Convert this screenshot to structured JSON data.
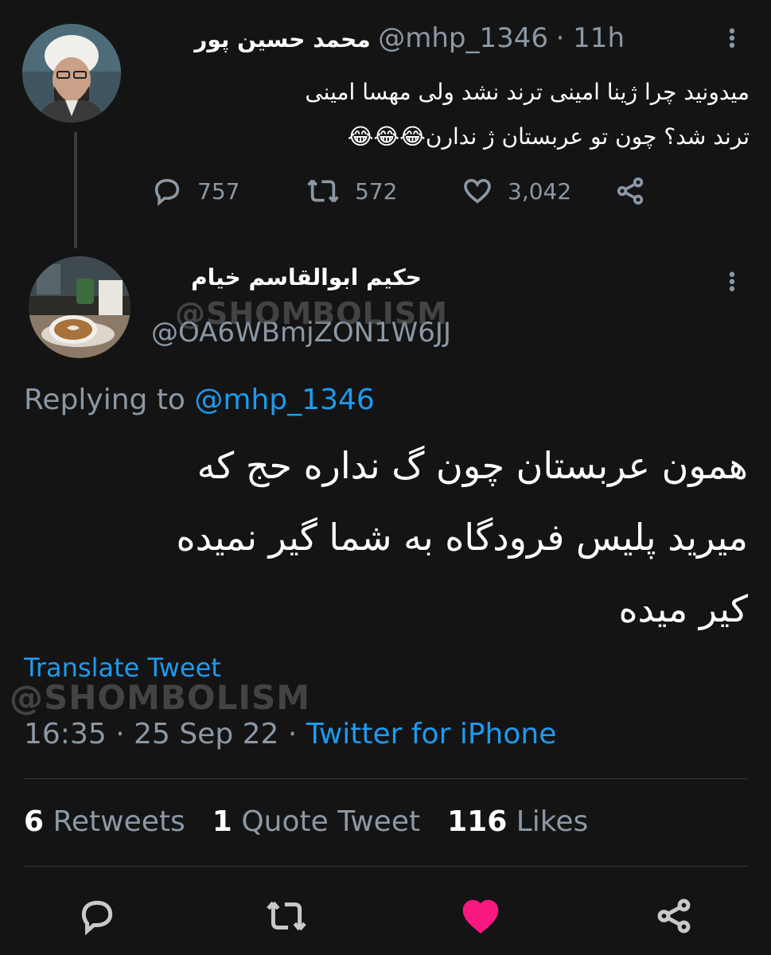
{
  "original_tweet": {
    "author_name": "محمد حسین پور",
    "handle": "@mhp_1346",
    "time": "· 11h",
    "text_line1": "میدونید چرا ژینا امینی ترند نشد ولی مهسا امینی",
    "text_line2": "ترند شد؟ چون تو عربستان ژ ندارن😂😂😂",
    "reply_count": "757",
    "retweet_count": "572",
    "like_count": "3,042"
  },
  "reply_tweet": {
    "author_name": "حکیم ابوالقاسم خیام",
    "handle": "@OA6WBmjZON1W6JJ",
    "replying_prefix": "Replying to",
    "replying_handle": "@mhp_1346",
    "text_line1": "همون عربستان چون گ نداره حج که",
    "text_line2": "میرید پلیس فرودگاه به شما گیر نمیده",
    "text_line3": "کیر میده",
    "translate_label": "Translate Tweet",
    "timestamp": "16:35 · 25 Sep 22 ·",
    "source": "Twitter for iPhone"
  },
  "stats": {
    "retweets_count": "6",
    "retweets_label": "Retweets",
    "quotes_count": "1",
    "quotes_label": "Quote Tweet",
    "likes_count": "116",
    "likes_label": "Likes"
  },
  "watermark": "@SHOMBOLISM",
  "colors": {
    "background": "#141414",
    "link": "#1d9bf0",
    "muted": "#8b98a5",
    "liked": "#f91880"
  },
  "icons": [
    "reply-icon",
    "retweet-icon",
    "like-icon",
    "share-icon",
    "more-icon"
  ]
}
